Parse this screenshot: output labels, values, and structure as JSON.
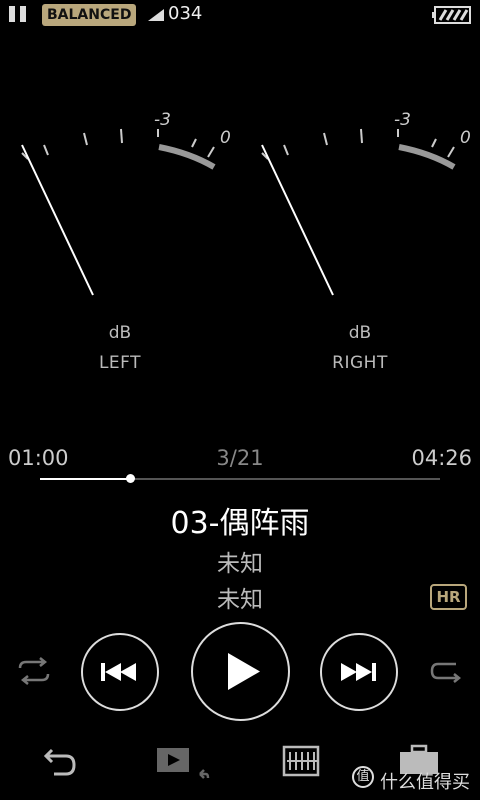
{
  "status_bar": {
    "output_mode": "BALANCED",
    "counter": "034",
    "icons": [
      "pause-icon",
      "signal-icon",
      "battery-icon"
    ]
  },
  "meters": {
    "left": {
      "unit": "dB",
      "channel": "LEFT",
      "scale_labels": [
        "-3",
        "0"
      ],
      "needle_level": 0.14
    },
    "right": {
      "unit": "dB",
      "channel": "RIGHT",
      "scale_labels": [
        "-3",
        "0"
      ],
      "needle_level": 0.14
    }
  },
  "progress": {
    "elapsed": "01:00",
    "position": "3/21",
    "total": "04:26",
    "fraction": 0.226
  },
  "track": {
    "number": "03-",
    "title": "偶阵雨",
    "artist": "未知",
    "album": "未知",
    "quality_badge": "HR"
  },
  "controls": {
    "icons": [
      "repeat-icon",
      "previous-icon",
      "play-icon",
      "next-icon",
      "shuffle-icon"
    ]
  },
  "bottom_bar": {
    "icons": [
      "back-icon",
      "video-return-icon",
      "equalizer-icon",
      "toolbox-icon"
    ]
  },
  "watermark": {
    "text": "什么值得买",
    "logo": "值"
  },
  "colors": {
    "accent_gold": "#b9a77c",
    "background": "#000000"
  }
}
